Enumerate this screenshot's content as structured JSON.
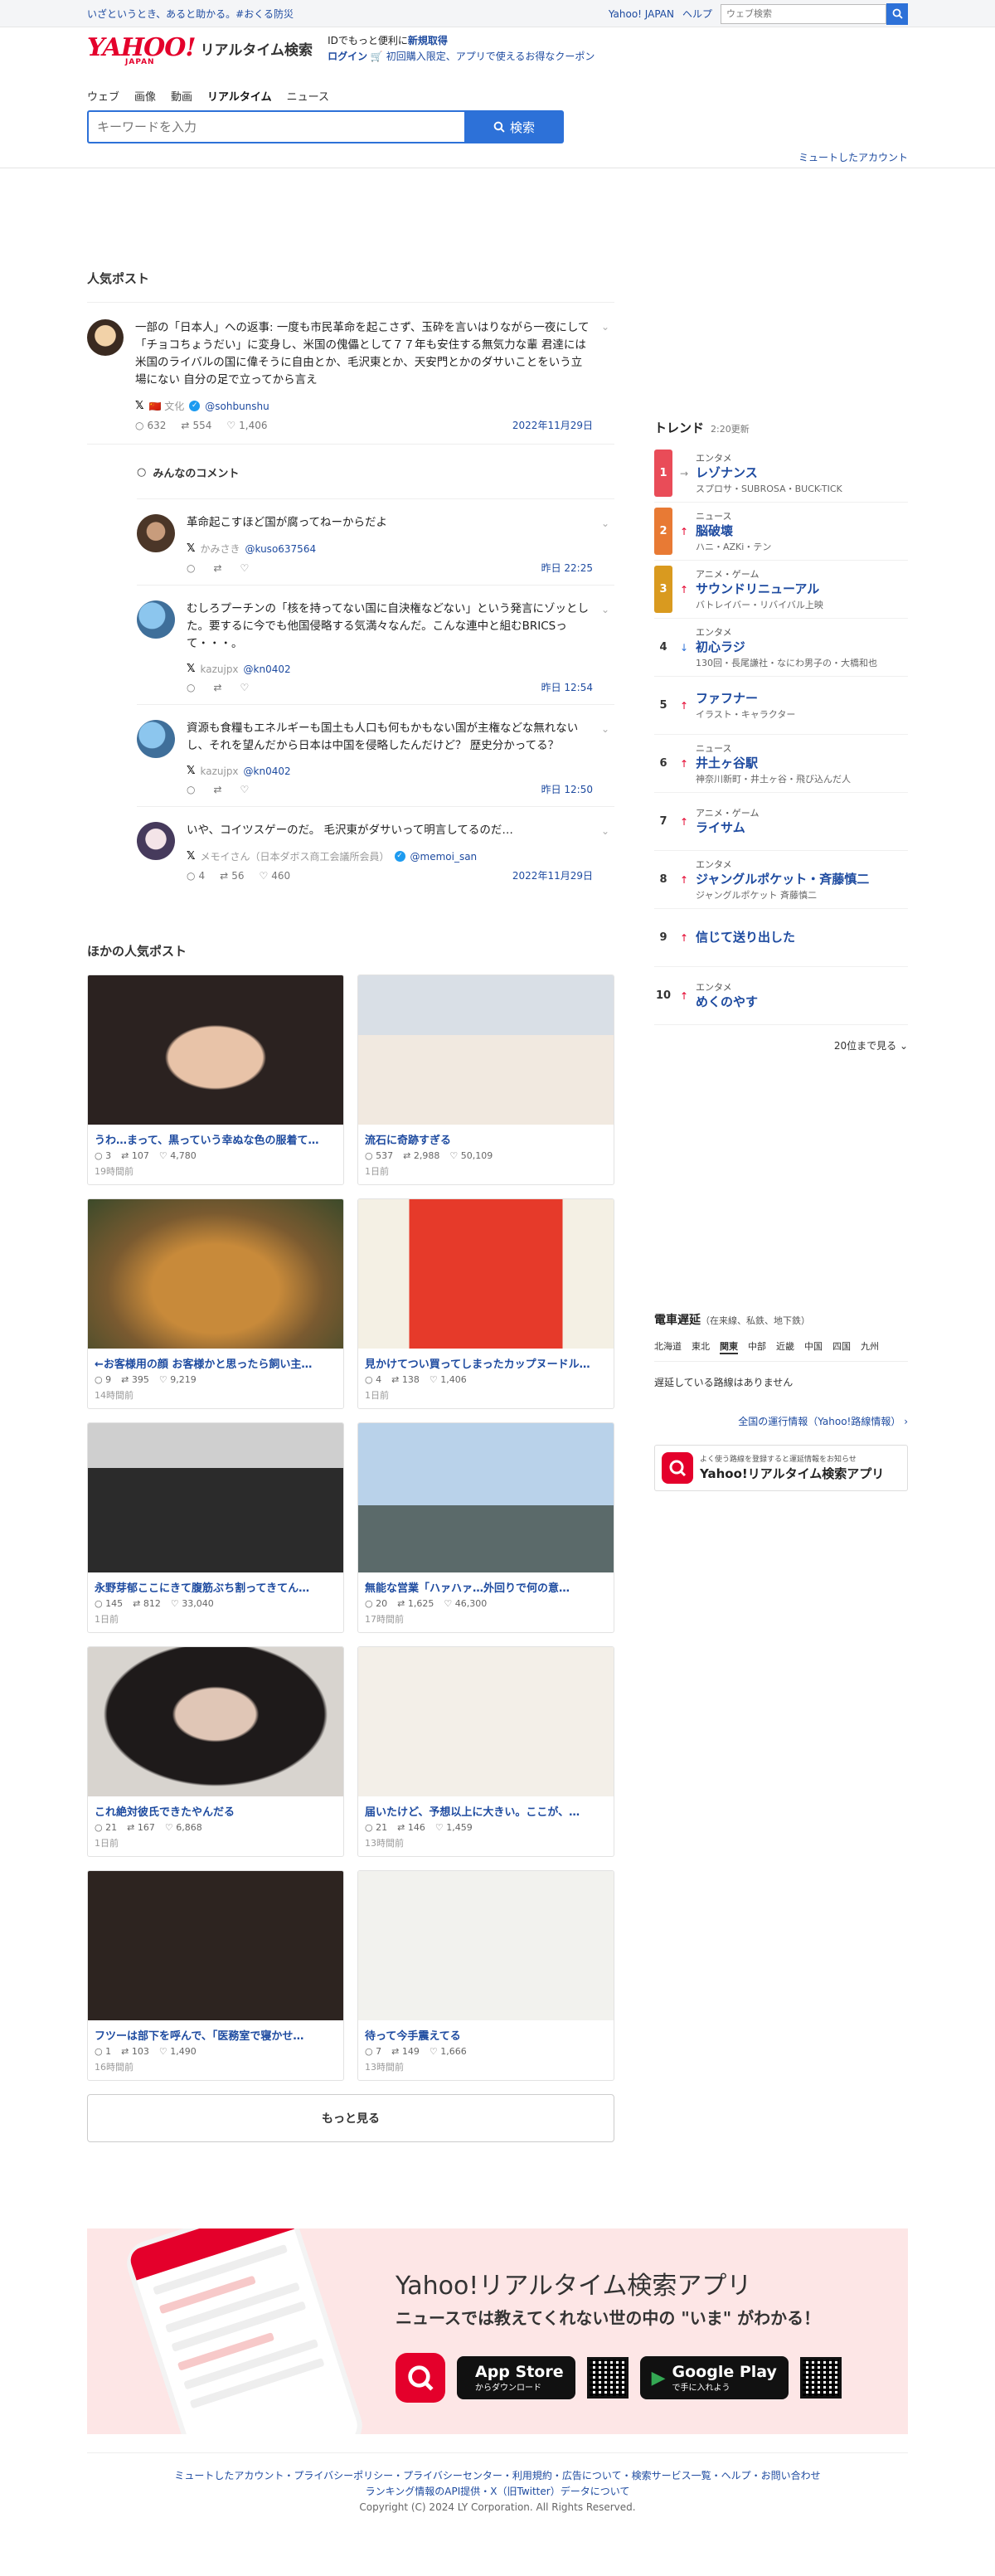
{
  "topbar": {
    "bosai": "いざというとき、あると助かる。#おくる防災",
    "links": [
      "Yahoo! JAPAN",
      "ヘルプ"
    ],
    "search_placeholder": "ウェブ検索"
  },
  "header": {
    "logo_main": "YAHOO!",
    "logo_sub": "JAPAN",
    "service_name": "リアルタイム検索",
    "login_line1_prefix": "IDでもっと便利に",
    "login_line1_link": "新規取得",
    "login_link": "ログイン",
    "coupon_text": "初回購入限定、アプリで使えるお得なクーポン",
    "tabs": [
      "ウェブ",
      "画像",
      "動画",
      "リアルタイム",
      "ニュース"
    ],
    "search_placeholder": "キーワードを入力",
    "search_button": "検索",
    "muted_accounts": "ミュートしたアカウント"
  },
  "popular": {
    "title": "人気ポスト",
    "main_post": {
      "text": "一部の「日本人」への返事: 一度も市民革命を起こさず、玉砕を言いはりながら一夜にして「チョコちょうだい」に変身し、米国の傀儡として７７年も安住する無気力な輩 君達には米国のライバルの国に偉そうに自由とか、毛沢東とか、天安門とかのダサいことをいう立場にない 自分の足で立ってから言え",
      "author": "🇨🇳 文化",
      "handle": "@sohbunshu",
      "replies": "632",
      "reposts": "554",
      "likes": "1,406",
      "date": "2022年11月29日"
    },
    "comments_title": "みんなのコメント",
    "comments": [
      {
        "text": "革命起こすほど国が腐ってねーからだよ",
        "author": "かみさき",
        "handle": "@kuso637564",
        "replies": "",
        "reposts": "",
        "likes": "",
        "date": "昨日 22:25"
      },
      {
        "text": "むしろプーチンの「核を持ってない国に自決権などない」という発言にゾッとした。要するに今でも他国侵略する気満々なんだ。こんな連中と組むBRICSって・・・。",
        "author": "kazujpx",
        "handle": "@kn0402",
        "replies": "",
        "reposts": "",
        "likes": "",
        "date": "昨日 12:54"
      },
      {
        "text": "資源も食糧もエネルギーも国土も人口も何もかもない国が主権などな無れないし、それを望んだから日本は中国を侵略したんだけど？ 歴史分かってる？",
        "author": "kazujpx",
        "handle": "@kn0402",
        "replies": "",
        "reposts": "",
        "likes": "",
        "date": "昨日 12:50"
      },
      {
        "text": "いや、コイツスゲーのだ。 毛沢東がダサいって明言してるのだ…",
        "author": "メモイさん（日本ダボス商工会議所会員）",
        "handle": "@memoi_san",
        "replies": "4",
        "reposts": "56",
        "likes": "460",
        "date": "2022年11月29日"
      }
    ]
  },
  "others": {
    "title": "ほかの人気ポスト",
    "cards": [
      {
        "caption": "うわ…まって、黒っていう幸ぬな色の服着て…",
        "replies": "3",
        "reposts": "107",
        "likes": "4,780",
        "ago": "19時間前"
      },
      {
        "caption": "流石に奇跡すぎる",
        "replies": "537",
        "reposts": "2,988",
        "likes": "50,109",
        "ago": "1日前"
      },
      {
        "caption": "←お客様用の顔 お客様かと思ったら飼い主…",
        "replies": "9",
        "reposts": "395",
        "likes": "9,219",
        "ago": "14時間前"
      },
      {
        "caption": "見かけてつい買ってしまったカップヌードル…",
        "replies": "4",
        "reposts": "138",
        "likes": "1,406",
        "ago": "1日前"
      },
      {
        "caption": "永野芽郁ここにきて腹筋ぶち割ってきてん…",
        "replies": "145",
        "reposts": "812",
        "likes": "33,040",
        "ago": "1日前"
      },
      {
        "caption": "無能な営業「ハァハァ…外回りで何の意…",
        "replies": "20",
        "reposts": "1,625",
        "likes": "46,300",
        "ago": "17時間前"
      },
      {
        "caption": "これ絶対彼氏できたやんだる",
        "replies": "21",
        "reposts": "167",
        "likes": "6,868",
        "ago": "1日前"
      },
      {
        "caption": "届いたけど、予想以上に大きい。ここが、…",
        "replies": "21",
        "reposts": "146",
        "likes": "1,459",
        "ago": "13時間前"
      },
      {
        "caption": "フツーは部下を呼んで、「医務室で寝かせ…",
        "replies": "1",
        "reposts": "103",
        "likes": "1,490",
        "ago": "16時間前"
      },
      {
        "caption": "待って今手震えてる",
        "replies": "7",
        "reposts": "149",
        "likes": "1,666",
        "ago": "13時間前"
      }
    ],
    "more_button": "もっと見る"
  },
  "trends": {
    "title": "トレンド",
    "updated": "2:20更新",
    "items": [
      {
        "rank": "1",
        "dir": "st",
        "cat": "エンタメ",
        "name": "レゾナンス",
        "sub": "スプロサ・SUBROSA・BUCK-TICK"
      },
      {
        "rank": "2",
        "dir": "up",
        "cat": "ニュース",
        "name": "脳破壊",
        "sub": "ハニ・AZKi・テン"
      },
      {
        "rank": "3",
        "dir": "up",
        "cat": "アニメ・ゲーム",
        "name": "サウンドリニューアル",
        "sub": "バトレイバー・リバイバル上映"
      },
      {
        "rank": "4",
        "dir": "dn",
        "cat": "エンタメ",
        "name": "初心ラジ",
        "sub": "130回・長尾謙社・なにわ男子の・大橋和也"
      },
      {
        "rank": "5",
        "dir": "up",
        "cat": "",
        "name": "ファフナー",
        "sub": "イラスト・キャラクター"
      },
      {
        "rank": "6",
        "dir": "up",
        "cat": "ニュース",
        "name": "井土ヶ谷駅",
        "sub": "神奈川新町・井土ヶ谷・飛び込んだ人"
      },
      {
        "rank": "7",
        "dir": "up",
        "cat": "アニメ・ゲーム",
        "name": "ライサム",
        "sub": ""
      },
      {
        "rank": "8",
        "dir": "up",
        "cat": "エンタメ",
        "name": "ジャングルポケット・斉藤慎二",
        "sub": "ジャングルポケット 斉藤慎二"
      },
      {
        "rank": "9",
        "dir": "up",
        "cat": "",
        "name": "信じて送り出した",
        "sub": ""
      },
      {
        "rank": "10",
        "dir": "up",
        "cat": "エンタメ",
        "name": "めくのやす",
        "sub": ""
      }
    ],
    "show_20": "20位まで見る"
  },
  "train": {
    "title": "電車遅延",
    "title_sub": "（在来線、私鉄、地下鉄）",
    "regions": [
      "北海道",
      "東北",
      "関東",
      "中部",
      "近畿",
      "中国",
      "四国",
      "九州"
    ],
    "none": "遅延している路線はありません",
    "all_link": "全国の運行情報（Yahoo!路線情報）",
    "app_text": "よく使う路線を登録すると運延情報をお知らせ",
    "app_name": "Yahoo!リアルタイム検索アプリ"
  },
  "promo": {
    "title": "Yahoo!リアルタイム検索アプリ",
    "subtitle": "ニュースでは教えてくれない世の中の \"いま\" がわかる！",
    "appstore_small": "からダウンロード",
    "appstore_big": "App Store",
    "gplay_small": "で手に入れよう",
    "gplay_big": "Google Play"
  },
  "footer": {
    "line1": "ミュートしたアカウント・プライバシーポリシー・プライバシーセンター・利用規約・広告について・検索サービス一覧・ヘルプ・お問い合わせ",
    "line2": "ランキング情報のAPI提供・X（旧Twitter）データについて",
    "copyright": "Copyright (C) 2024 LY Corporation. All Rights Reserved."
  },
  "colors": {
    "accent": "#2d71d8",
    "brand": "#e4002b",
    "link": "#1e4ba0"
  }
}
